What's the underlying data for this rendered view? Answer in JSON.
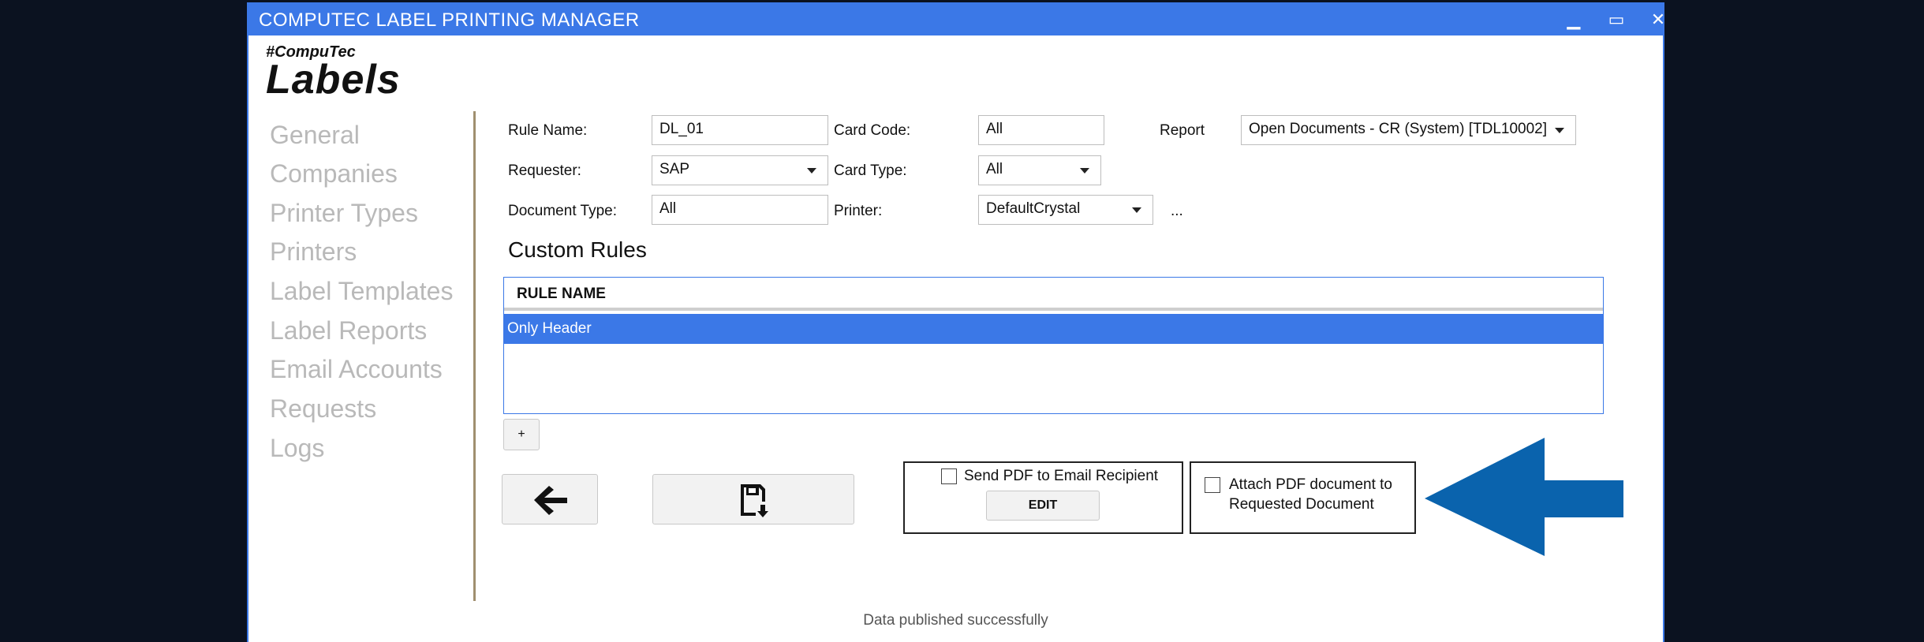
{
  "window": {
    "title": "COMPUTEC LABEL PRINTING MANAGER",
    "minimize": "▁",
    "maximize": "▭",
    "close": "✕"
  },
  "logo": {
    "hash": "#CompuTec",
    "main": "Labels"
  },
  "sidebar": {
    "items": [
      {
        "label": "General"
      },
      {
        "label": "Companies"
      },
      {
        "label": "Printer Types"
      },
      {
        "label": "Printers"
      },
      {
        "label": "Label Templates"
      },
      {
        "label": "Label Reports"
      },
      {
        "label": "Email Accounts"
      },
      {
        "label": "Requests"
      },
      {
        "label": "Logs"
      }
    ]
  },
  "form": {
    "rule_name_label": "Rule Name:",
    "rule_name_value": "DL_01",
    "card_code_label": "Card Code:",
    "card_code_value": "All",
    "report_label": "Report",
    "report_value": "Open Documents - CR (System)  [TDL10002]",
    "requester_label": "Requester:",
    "requester_value": "SAP",
    "card_type_label": "Card Type:",
    "card_type_value": "All",
    "document_type_label": "Document Type:",
    "document_type_value": "All",
    "printer_label": "Printer:",
    "printer_value": "DefaultCrystal",
    "printer_more": "..."
  },
  "custom_rules": {
    "title": "Custom Rules",
    "column_header": "RULE NAME",
    "rows": [
      {
        "name": "Only Header"
      }
    ],
    "add_label": "+"
  },
  "email_box": {
    "checkbox_label": "Send PDF to Email Recipient",
    "edit_label": "EDIT"
  },
  "attach_box": {
    "line1": "Attach PDF document to",
    "line2": "Requested Document"
  },
  "status": "Data published successfully",
  "colors": {
    "accent": "#3b78e7",
    "arrow": "#0a63ad",
    "divider": "#a08f6f"
  }
}
